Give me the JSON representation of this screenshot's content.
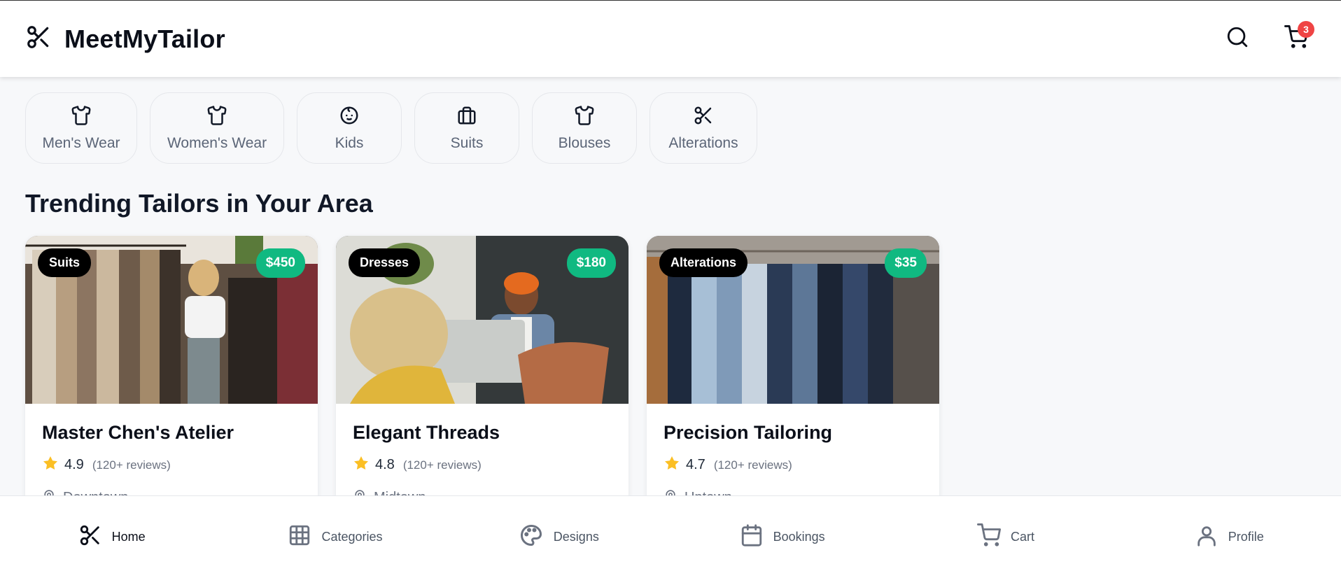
{
  "header": {
    "brand": "MeetMyTailor",
    "cart_count": "3"
  },
  "categories": [
    {
      "label": "Men's Wear",
      "icon": "shirt-icon"
    },
    {
      "label": "Women's Wear",
      "icon": "shirt-icon"
    },
    {
      "label": "Kids",
      "icon": "baby-icon"
    },
    {
      "label": "Suits",
      "icon": "briefcase-icon"
    },
    {
      "label": "Blouses",
      "icon": "shirt-icon"
    },
    {
      "label": "Alterations",
      "icon": "scissors-icon"
    }
  ],
  "section": {
    "title": "Trending Tailors in Your Area"
  },
  "tailors": [
    {
      "tag": "Suits",
      "price": "$450",
      "name": "Master Chen's Atelier",
      "rating": "4.9",
      "reviews": "(120+ reviews)",
      "location": "Downtown"
    },
    {
      "tag": "Dresses",
      "price": "$180",
      "name": "Elegant Threads",
      "rating": "4.8",
      "reviews": "(120+ reviews)",
      "location": "Midtown"
    },
    {
      "tag": "Alterations",
      "price": "$35",
      "name": "Precision Tailoring",
      "rating": "4.7",
      "reviews": "(120+ reviews)",
      "location": "Uptown"
    }
  ],
  "bottom_nav": [
    {
      "label": "Home",
      "icon": "scissors-icon",
      "active": true
    },
    {
      "label": "Categories",
      "icon": "grid-icon"
    },
    {
      "label": "Designs",
      "icon": "palette-icon"
    },
    {
      "label": "Bookings",
      "icon": "calendar-icon"
    },
    {
      "label": "Cart",
      "icon": "cart-icon"
    },
    {
      "label": "Profile",
      "icon": "user-icon"
    }
  ],
  "colors": {
    "price_badge": "#10b981",
    "cart_badge": "#ef4444",
    "star": "#fbbf24"
  }
}
